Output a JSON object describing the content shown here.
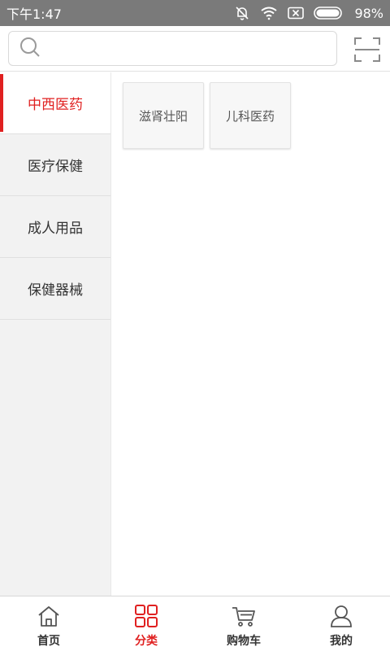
{
  "status_bar": {
    "time": "下午1:47",
    "battery": "98%"
  },
  "search": {
    "placeholder": "",
    "value": ""
  },
  "categories": [
    {
      "label": "中西医药",
      "active": true
    },
    {
      "label": "医疗保健",
      "active": false
    },
    {
      "label": "成人用品",
      "active": false
    },
    {
      "label": "保健器械",
      "active": false
    }
  ],
  "subcategories": [
    {
      "label": "滋肾壮阳"
    },
    {
      "label": "儿科医药"
    }
  ],
  "tabs": [
    {
      "label": "首页",
      "icon": "home-icon",
      "active": false
    },
    {
      "label": "分类",
      "icon": "category-grid-icon",
      "active": true
    },
    {
      "label": "购物车",
      "icon": "cart-icon",
      "active": false
    },
    {
      "label": "我的",
      "icon": "user-icon",
      "active": false
    }
  ],
  "colors": {
    "accent": "#e02020",
    "status_bar": "#7a7a7a",
    "nav_background": "#f2f2f2"
  }
}
